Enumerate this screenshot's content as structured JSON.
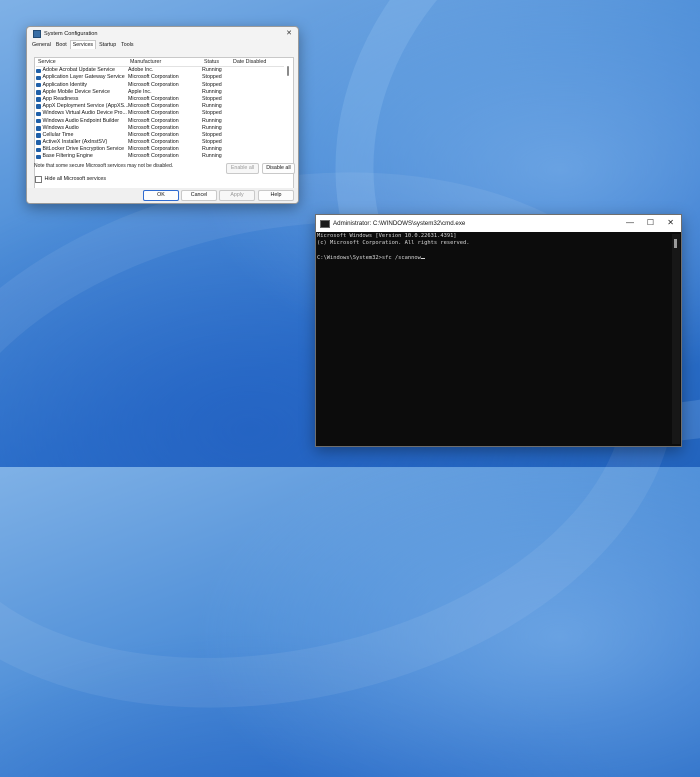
{
  "msconfig": {
    "title": "System Configuration",
    "close_glyph": "✕",
    "tabs": [
      "General",
      "Boot",
      "Services",
      "Startup",
      "Tools"
    ],
    "active_tab": "Services",
    "columns": [
      "Service",
      "Manufacturer",
      "Status",
      "Date Disabled"
    ],
    "services": [
      {
        "name": "Adobe Acrobat Update Service",
        "manufacturer": "Adobe Inc.",
        "status": "Running"
      },
      {
        "name": "Application Layer Gateway Service",
        "manufacturer": "Microsoft Corporation",
        "status": "Stopped"
      },
      {
        "name": "Application Identity",
        "manufacturer": "Microsoft Corporation",
        "status": "Stopped"
      },
      {
        "name": "Apple Mobile Device Service",
        "manufacturer": "Apple Inc.",
        "status": "Running"
      },
      {
        "name": "App Readiness",
        "manufacturer": "Microsoft Corporation",
        "status": "Stopped"
      },
      {
        "name": "AppX Deployment Service (AppXS...",
        "manufacturer": "Microsoft Corporation",
        "status": "Running"
      },
      {
        "name": "Windows Virtual Audio Device Pro...",
        "manufacturer": "Microsoft Corporation",
        "status": "Stopped"
      },
      {
        "name": "Windows Audio Endpoint Builder",
        "manufacturer": "Microsoft Corporation",
        "status": "Running"
      },
      {
        "name": "Windows Audio",
        "manufacturer": "Microsoft Corporation",
        "status": "Running"
      },
      {
        "name": "Cellular Time",
        "manufacturer": "Microsoft Corporation",
        "status": "Stopped"
      },
      {
        "name": "ActiveX Installer (AxInstSV)",
        "manufacturer": "Microsoft Corporation",
        "status": "Stopped"
      },
      {
        "name": "BitLocker Drive Encryption Service",
        "manufacturer": "Microsoft Corporation",
        "status": "Running"
      },
      {
        "name": "Base Filtering Engine",
        "manufacturer": "Microsoft Corporation",
        "status": "Running"
      }
    ],
    "note": "Note that some secure Microsoft services may not be disabled.",
    "enable_all": "Enable all",
    "disable_all": "Disable all",
    "hide_ms_label": "Hide all Microsoft services",
    "ok": "OK",
    "cancel": "Cancel",
    "apply": "Apply",
    "help": "Help"
  },
  "cmd": {
    "title": "Administrator: C:\\WINDOWS\\system32\\cmd.exe",
    "minimize_glyph": "—",
    "maximize_glyph": "☐",
    "close_glyph": "✕",
    "lines": [
      "Microsoft Windows [Version 10.0.22631.4391]",
      "(c) Microsoft Corporation. All rights reserved.",
      "",
      "C:\\Windows\\System32>sfc /scannow"
    ]
  }
}
